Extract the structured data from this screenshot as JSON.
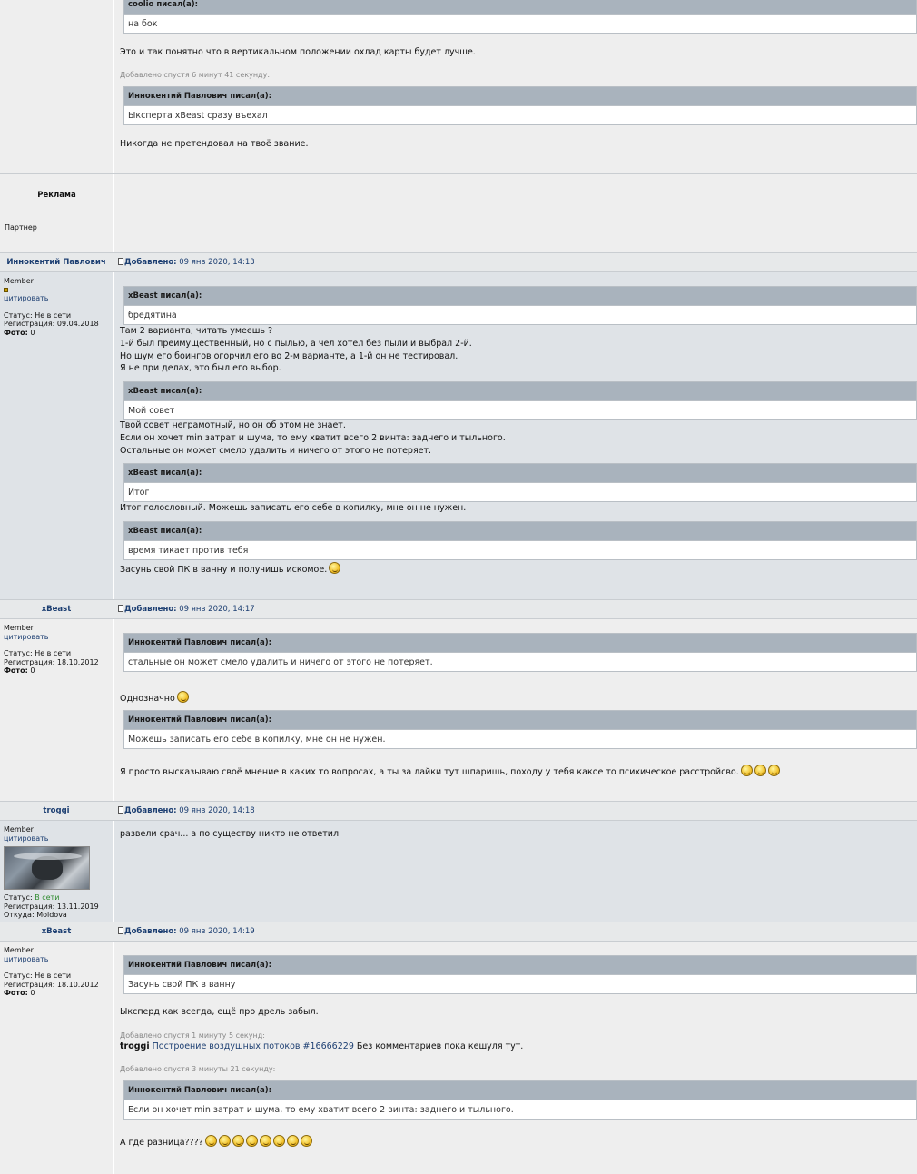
{
  "post0": {
    "quote1_author": "coolio писал(а):",
    "quote1_text": "на бок",
    "line1": "Это и так понятно что в вертикальном положении охлад карты будет лучше.",
    "added": "Добавлено спустя 6 минут 41 секунду:",
    "quote2_author": "Иннокентий Павлович писал(а):",
    "quote2_text": "Ыксперта xBeast сразу въехал",
    "line2": "Никогда не претендовал на твоё звание."
  },
  "ad": {
    "title": "Реклама",
    "subtitle": "Партнер"
  },
  "post1": {
    "author": "Иннокентий Павлович",
    "label": "Добавлено:",
    "date": "09 янв 2020, 14:13",
    "role": "Member",
    "cite": "цитировать",
    "status_label": "Статус:",
    "status": "Не в сети",
    "reg_label": "Регистрация:",
    "reg": "09.04.2018",
    "photo_label": "Фото:",
    "photo": "0",
    "q1_author": "xBeast писал(а):",
    "q1_text": "бредятина",
    "t1": "Там 2 варианта, читать умеешь ?",
    "t2": "1-й был преимущественный, но с пылью, а чел хотел без пыли и выбрал 2-й.",
    "t3": "Но шум его боингов огорчил его во 2-м варианте, а 1-й он не тестировал.",
    "t4": "Я не при делах, это был его выбор.",
    "q2_author": "xBeast писал(а):",
    "q2_text": "Мой совет",
    "t5": "Твой совет неграмотный, но он об этом не знает.",
    "t6": "Если он хочет min затрат и шума, то ему хватит всего 2 винта: заднего и тыльного.",
    "t7": "Остальные он может смело удалить и ничего от этого не потеряет.",
    "q3_author": "xBeast писал(а):",
    "q3_text": "Итог",
    "t8": "Итог голословный. Можешь записать его себе в копилку, мне он не нужен.",
    "q4_author": "xBeast писал(а):",
    "q4_text": "время тикает против тебя",
    "t9": "Засунь свой ПК в ванну и получишь искомое."
  },
  "post2": {
    "author": "xBeast",
    "label": "Добавлено:",
    "date": "09 янв 2020, 14:17",
    "role": "Member",
    "cite": "цитировать",
    "status_label": "Статус:",
    "status": "Не в сети",
    "reg_label": "Регистрация:",
    "reg": "18.10.2012",
    "photo_label": "Фото:",
    "photo": "0",
    "q1_author": "Иннокентий Павлович писал(а):",
    "q1_text": "стальные он может смело удалить и ничего от этого не потеряет.",
    "t1": "Однозначно",
    "q2_author": "Иннокентий Павлович писал(а):",
    "q2_text": "Можешь записать его себе в копилку, мне он не нужен.",
    "t2": "Я просто высказываю своё мнение в каких то вопросах, а ты за лайки тут шпаришь, походу у тебя какое то психическое расстройсво."
  },
  "post3": {
    "author": "troggi",
    "label": "Добавлено:",
    "date": "09 янв 2020, 14:18",
    "role": "Member",
    "cite": "цитировать",
    "status_label": "Статус:",
    "status": "В сети",
    "reg_label": "Регистрация:",
    "reg": "13.11.2019",
    "from_label": "Откуда:",
    "from": "Moldova",
    "t1": "развели срач... а по существу никто не ответил."
  },
  "post4": {
    "author": "xBeast",
    "label": "Добавлено:",
    "date": "09 янв 2020, 14:19",
    "role": "Member",
    "cite": "цитировать",
    "status_label": "Статус:",
    "status": "Не в сети",
    "reg_label": "Регистрация:",
    "reg": "18.10.2012",
    "photo_label": "Фото:",
    "photo": "0",
    "q1_author": "Иннокентий Павлович писал(а):",
    "q1_text": "Засунь свой ПК в ванну",
    "t1": "Ыксперд как всегда, ещё про дрель забыл.",
    "added1": "Добавлено спустя 1 минуту 5 секунд:",
    "ref_user": "troggi",
    "ref_link": "Построение воздушных потоков #16666229",
    "ref_rest": "Без комментариев пока кешуля тут.",
    "added2": "Добавлено спустя 3 минуты 21 секунду:",
    "q2_author": "Иннокентий Павлович писал(а):",
    "q2_text": "Если он хочет min затрат и шума, то ему хватит всего 2 винта: заднего и тыльного.",
    "t2": "А где разница????"
  }
}
